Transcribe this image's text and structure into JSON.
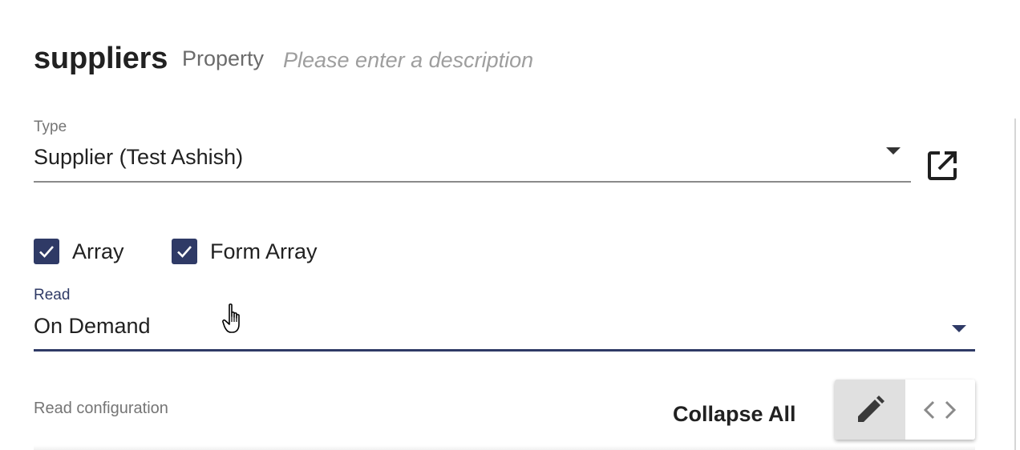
{
  "header": {
    "property_name": "suppliers",
    "property_kind": "Property",
    "description_placeholder": "Please enter a description"
  },
  "type_field": {
    "label": "Type",
    "value": "Supplier (Test Ashish)",
    "open_icon": "open-in-new-icon"
  },
  "checkboxes": [
    {
      "label": "Array",
      "checked": true
    },
    {
      "label": "Form Array",
      "checked": true
    }
  ],
  "read_field": {
    "label": "Read",
    "value": "On Demand"
  },
  "read_configuration": {
    "label": "Read configuration",
    "collapse_all_label": "Collapse All",
    "view_toggle": [
      {
        "icon": "pencil-icon",
        "selected": true
      },
      {
        "icon": "code-icon",
        "selected": false
      }
    ]
  },
  "colors": {
    "accent": "#2f3a66",
    "text": "#212121",
    "muted": "#757575",
    "toggle_selected": "#e0e0e0"
  }
}
